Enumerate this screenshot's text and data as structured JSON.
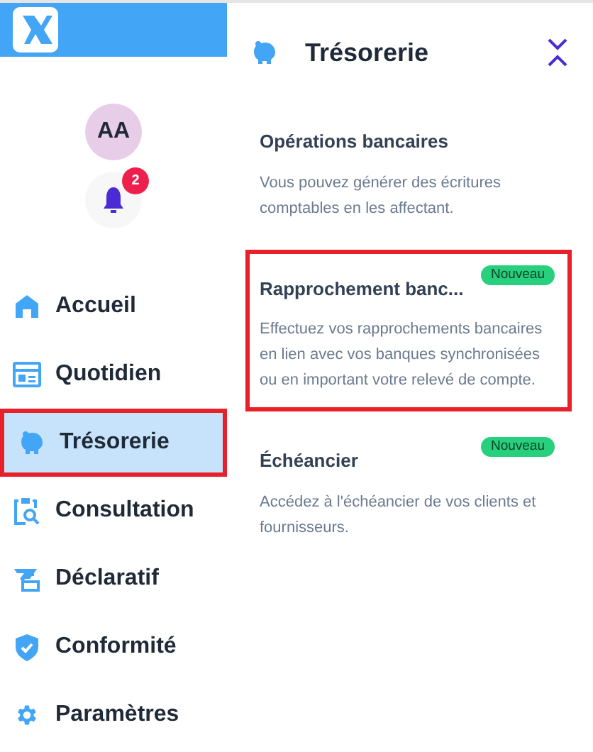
{
  "sidebar": {
    "avatar": "AA",
    "notifications": "2",
    "items": [
      {
        "kind": "home",
        "label": "Accueil",
        "selected": false,
        "highlighted": false
      },
      {
        "kind": "calendar",
        "label": "Quotidien",
        "selected": false,
        "highlighted": false
      },
      {
        "kind": "piggy",
        "label": "Trésorerie",
        "selected": true,
        "highlighted": true
      },
      {
        "kind": "search",
        "label": "Consultation",
        "selected": false,
        "highlighted": false
      },
      {
        "kind": "declare",
        "label": "Déclaratif",
        "selected": false,
        "highlighted": false
      },
      {
        "kind": "shield",
        "label": "Conformité",
        "selected": false,
        "highlighted": false
      },
      {
        "kind": "gear",
        "label": "Paramètres",
        "selected": false,
        "highlighted": false
      }
    ]
  },
  "panel": {
    "title": "Trésorerie",
    "entries": [
      {
        "title": "Opérations bancaires",
        "description": "Vous pouvez générer des écritures comptables en les affectant.",
        "highlighted": false
      },
      {
        "title": "Rapprochement banc...",
        "badge": "Nouveau",
        "description": "Effectuez vos rapprochements bancaires en lien avec vos banques synchronisées ou en important votre relevé de compte.",
        "highlighted": true
      },
      {
        "title": "Échéancier",
        "badge": "Nouveau",
        "description": "Accédez à l'échéancier de vos clients et fournisseurs.",
        "highlighted": false
      }
    ]
  }
}
